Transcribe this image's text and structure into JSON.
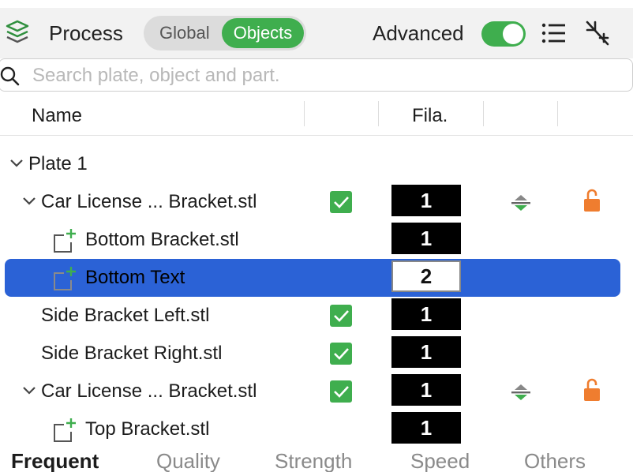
{
  "header": {
    "title": "Process",
    "segments": [
      "Global",
      "Objects"
    ],
    "active_segment": "Objects",
    "advanced_label": "Advanced",
    "advanced_enabled": true
  },
  "search": {
    "placeholder": "Search plate, object and part.",
    "value": ""
  },
  "columns": {
    "name": "Name",
    "filament": "Fila."
  },
  "tree": {
    "plate": "Plate 1",
    "rows": [
      {
        "label": "Car License ... Bracket.stl",
        "filament": "1",
        "checked": true,
        "plane_icon": true,
        "lock_icon": true
      },
      {
        "label": "Bottom Bracket.stl",
        "filament": "1"
      },
      {
        "label": "Bottom Text",
        "filament": "2",
        "selected": true
      },
      {
        "label": "Side Bracket Left.stl",
        "filament": "1",
        "checked": true
      },
      {
        "label": "Side Bracket Right.stl",
        "filament": "1",
        "checked": true
      },
      {
        "label": "Car License ... Bracket.stl",
        "filament": "1",
        "checked": true,
        "plane_icon": true,
        "lock_icon": true
      },
      {
        "label": "Top Bracket.stl",
        "filament": "1"
      }
    ]
  },
  "tabs": {
    "items": [
      "Frequent",
      "Quality",
      "Strength",
      "Speed",
      "Others"
    ],
    "active": "Frequent"
  },
  "colors": {
    "accent_green": "#3fae4e",
    "selection_blue": "#2b62d6",
    "lock_orange": "#ef7d2f",
    "filament_1": "#000000",
    "filament_2": "#ffffff"
  },
  "icons": [
    "layers-icon",
    "list-icon",
    "collapse-icon",
    "search-icon",
    "chevron-down-icon",
    "add-part-icon",
    "checkbox-checked-icon",
    "plane-cut-icon",
    "lock-open-icon"
  ]
}
